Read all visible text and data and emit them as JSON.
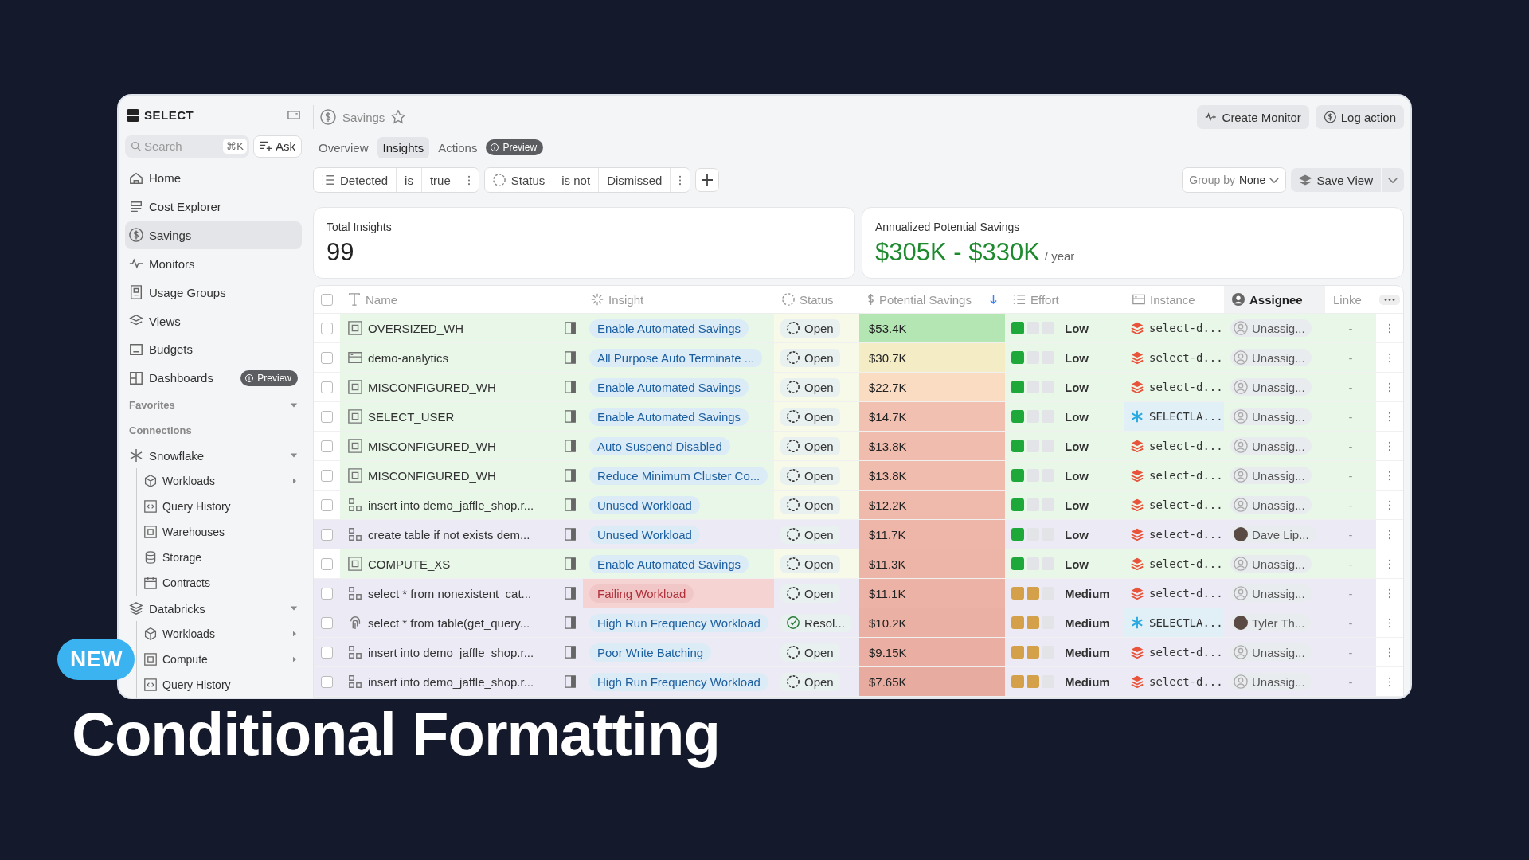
{
  "promo": {
    "badge": "NEW",
    "title": "Conditional Formatting"
  },
  "sidebar": {
    "logo": "SELECT",
    "search": {
      "placeholder": "Search",
      "shortcut": "⌘K"
    },
    "ask": "Ask",
    "nav": [
      {
        "label": "Home",
        "selected": false
      },
      {
        "label": "Cost Explorer",
        "selected": false
      },
      {
        "label": "Savings",
        "selected": true
      },
      {
        "label": "Monitors",
        "selected": false
      },
      {
        "label": "Usage Groups",
        "selected": false
      },
      {
        "label": "Views",
        "selected": false
      },
      {
        "label": "Budgets",
        "selected": false
      },
      {
        "label": "Dashboards",
        "selected": false,
        "badge": "Preview"
      }
    ],
    "favorites": {
      "title": "Favorites",
      "expanded": true
    },
    "connections": {
      "title": "Connections",
      "groups": [
        {
          "label": "Snowflake",
          "kind": "snowflake",
          "expanded": true,
          "children": [
            {
              "label": "Workloads",
              "kind": "cube",
              "expandable": true
            },
            {
              "label": "Query History",
              "kind": "code",
              "expandable": false
            },
            {
              "label": "Warehouses",
              "kind": "square",
              "expandable": false
            },
            {
              "label": "Storage",
              "kind": "database",
              "expandable": false
            },
            {
              "label": "Contracts",
              "kind": "calendar",
              "expandable": false
            }
          ]
        },
        {
          "label": "Databricks",
          "kind": "databricks",
          "expanded": true,
          "children": [
            {
              "label": "Workloads",
              "kind": "cube",
              "expandable": true
            },
            {
              "label": "Compute",
              "kind": "square",
              "expandable": true
            },
            {
              "label": "Query History",
              "kind": "code",
              "expandable": false
            }
          ]
        }
      ]
    }
  },
  "header": {
    "title": "Savings",
    "actions": [
      "Create Monitor",
      "Log action"
    ]
  },
  "tabs": [
    {
      "label": "Overview",
      "selected": false
    },
    {
      "label": "Insights",
      "selected": true
    },
    {
      "label": "Actions",
      "selected": false
    }
  ],
  "tabs_badge": "Preview",
  "filters": [
    {
      "kind": "list",
      "field": "Detected",
      "op": "is",
      "value": "true"
    },
    {
      "kind": "status",
      "field": "Status",
      "op": "is not",
      "value": "Dismissed"
    }
  ],
  "group_by": {
    "label": "Group by",
    "value": "None"
  },
  "save_view": "Save View",
  "cards": [
    {
      "label": "Total Insights",
      "value": "99",
      "kind": "count"
    },
    {
      "label": "Annualized Potential Savings",
      "value": "$305K - $330K",
      "unit": "/ year",
      "kind": "money"
    }
  ],
  "table": {
    "select_all": {
      "checked": false
    },
    "columns": [
      {
        "label": "Name",
        "selected": false,
        "sorted": false
      },
      {
        "label": "Insight",
        "selected": false,
        "sorted": false
      },
      {
        "label": "Status",
        "selected": false,
        "sorted": false
      },
      {
        "label": "Potential Savings",
        "selected": false,
        "sorted": true
      },
      {
        "label": "Effort",
        "selected": false,
        "sorted": false
      },
      {
        "label": "Instance",
        "selected": false,
        "sorted": false
      },
      {
        "label": "Assignee",
        "selected": true,
        "sorted": false
      },
      {
        "label": "Linke",
        "selected": false,
        "sorted": false
      }
    ],
    "rows": [
      {
        "kind": "warehouse",
        "name": "OVERSIZED_WH",
        "highlighted": true,
        "insight": {
          "kind": "normal",
          "label": "Enable Automated Savings"
        },
        "status": {
          "kind": "open",
          "label": "Open"
        },
        "savings": "$53.4K",
        "color": "#b4e6b4",
        "effort": {
          "kind": "low",
          "label": "Low"
        },
        "instance": {
          "kind": "databricks",
          "label": "select-d..."
        },
        "assignee": {
          "kind": "unassigned",
          "label": "Unassig..."
        },
        "linked": "-"
      },
      {
        "kind": "cluster",
        "name": "demo-analytics",
        "highlighted": true,
        "insight": {
          "kind": "normal",
          "label": "All Purpose Auto Terminate ..."
        },
        "status": {
          "kind": "open",
          "label": "Open"
        },
        "savings": "$30.7K",
        "color": "#f4ecc4",
        "effort": {
          "kind": "low",
          "label": "Low"
        },
        "instance": {
          "kind": "databricks",
          "label": "select-d..."
        },
        "assignee": {
          "kind": "unassigned",
          "label": "Unassig..."
        },
        "linked": "-"
      },
      {
        "kind": "warehouse",
        "name": "MISCONFIGURED_WH",
        "highlighted": true,
        "insight": {
          "kind": "normal",
          "label": "Enable Automated Savings"
        },
        "status": {
          "kind": "open",
          "label": "Open"
        },
        "savings": "$22.7K",
        "color": "#fadcc2",
        "effort": {
          "kind": "low",
          "label": "Low"
        },
        "instance": {
          "kind": "databricks",
          "label": "select-d..."
        },
        "assignee": {
          "kind": "unassigned",
          "label": "Unassig..."
        },
        "linked": "-"
      },
      {
        "kind": "warehouse",
        "name": "SELECT_USER",
        "highlighted": true,
        "insight": {
          "kind": "normal",
          "label": "Enable Automated Savings"
        },
        "status": {
          "kind": "open",
          "label": "Open"
        },
        "savings": "$14.7K",
        "color": "#f2c0b0",
        "effort": {
          "kind": "low",
          "label": "Low"
        },
        "instance": {
          "kind": "snowflake",
          "label": "SELECTLA..."
        },
        "assignee": {
          "kind": "unassigned",
          "label": "Unassig..."
        },
        "linked": "-"
      },
      {
        "kind": "warehouse",
        "name": "MISCONFIGURED_WH",
        "highlighted": true,
        "insight": {
          "kind": "normal",
          "label": "Auto Suspend Disabled"
        },
        "status": {
          "kind": "open",
          "label": "Open"
        },
        "savings": "$13.8K",
        "color": "#f0bcae",
        "effort": {
          "kind": "low",
          "label": "Low"
        },
        "instance": {
          "kind": "databricks",
          "label": "select-d..."
        },
        "assignee": {
          "kind": "unassigned",
          "label": "Unassig..."
        },
        "linked": "-"
      },
      {
        "kind": "warehouse",
        "name": "MISCONFIGURED_WH",
        "highlighted": true,
        "insight": {
          "kind": "normal",
          "label": "Reduce Minimum Cluster Co..."
        },
        "status": {
          "kind": "open",
          "label": "Open"
        },
        "savings": "$13.8K",
        "color": "#f0bcae",
        "effort": {
          "kind": "low",
          "label": "Low"
        },
        "instance": {
          "kind": "databricks",
          "label": "select-d..."
        },
        "assignee": {
          "kind": "unassigned",
          "label": "Unassig..."
        },
        "linked": "-"
      },
      {
        "kind": "query",
        "name": "insert into demo_jaffle_shop.r...",
        "highlighted": true,
        "insight": {
          "kind": "normal",
          "label": "Unused Workload"
        },
        "status": {
          "kind": "open",
          "label": "Open"
        },
        "savings": "$12.2K",
        "color": "#efb9ab",
        "effort": {
          "kind": "low",
          "label": "Low"
        },
        "instance": {
          "kind": "databricks",
          "label": "select-d..."
        },
        "assignee": {
          "kind": "unassigned",
          "label": "Unassig..."
        },
        "linked": "-"
      },
      {
        "kind": "query",
        "name": "create table if not exists dem...",
        "highlighted": false,
        "insight": {
          "kind": "normal",
          "label": "Unused Workload"
        },
        "status": {
          "kind": "open",
          "label": "Open"
        },
        "savings": "$11.7K",
        "color": "#eeb6a9",
        "effort": {
          "kind": "low",
          "label": "Low"
        },
        "instance": {
          "kind": "databricks",
          "label": "select-d..."
        },
        "assignee": {
          "kind": "person",
          "label": "Dave Lip..."
        },
        "linked": "-"
      },
      {
        "kind": "warehouse",
        "name": "COMPUTE_XS",
        "highlighted": true,
        "insight": {
          "kind": "normal",
          "label": "Enable Automated Savings"
        },
        "status": {
          "kind": "open",
          "label": "Open"
        },
        "savings": "$11.3K",
        "color": "#edb4a8",
        "effort": {
          "kind": "low",
          "label": "Low"
        },
        "instance": {
          "kind": "databricks",
          "label": "select-d..."
        },
        "assignee": {
          "kind": "unassigned",
          "label": "Unassig..."
        },
        "linked": "-"
      },
      {
        "kind": "query",
        "name": "select * from nonexistent_cat...",
        "highlighted": false,
        "insight": {
          "kind": "failing",
          "label": "Failing Workload"
        },
        "status": {
          "kind": "open",
          "label": "Open"
        },
        "savings": "$11.1K",
        "color": "#ecb2a6",
        "effort": {
          "kind": "medium",
          "label": "Medium"
        },
        "instance": {
          "kind": "databricks",
          "label": "select-d..."
        },
        "assignee": {
          "kind": "unassigned",
          "label": "Unassig..."
        },
        "linked": "-"
      },
      {
        "kind": "fingerprint",
        "name": "select * from table(get_query...",
        "highlighted": false,
        "insight": {
          "kind": "normal",
          "label": "High Run Frequency Workload"
        },
        "status": {
          "kind": "resolved",
          "label": "Resol..."
        },
        "savings": "$10.2K",
        "color": "#ebb0a4",
        "effort": {
          "kind": "medium",
          "label": "Medium"
        },
        "instance": {
          "kind": "snowflake",
          "label": "SELECTLA..."
        },
        "assignee": {
          "kind": "person",
          "label": "Tyler Th..."
        },
        "linked": "-"
      },
      {
        "kind": "query",
        "name": "insert into demo_jaffle_shop.r...",
        "highlighted": false,
        "insight": {
          "kind": "normal",
          "label": "Poor Write Batching"
        },
        "status": {
          "kind": "open",
          "label": "Open"
        },
        "savings": "$9.15K",
        "color": "#eaaea3",
        "effort": {
          "kind": "medium",
          "label": "Medium"
        },
        "instance": {
          "kind": "databricks",
          "label": "select-d..."
        },
        "assignee": {
          "kind": "unassigned",
          "label": "Unassig..."
        },
        "linked": "-"
      },
      {
        "kind": "query",
        "name": "insert into demo_jaffle_shop.r...",
        "highlighted": false,
        "insight": {
          "kind": "normal",
          "label": "High Run Frequency Workload"
        },
        "status": {
          "kind": "open",
          "label": "Open"
        },
        "savings": "$7.65K",
        "color": "#e8aba0",
        "effort": {
          "kind": "medium",
          "label": "Medium"
        },
        "instance": {
          "kind": "databricks",
          "label": "select-d..."
        },
        "assignee": {
          "kind": "unassigned",
          "label": "Unassig..."
        },
        "linked": "-"
      }
    ]
  }
}
